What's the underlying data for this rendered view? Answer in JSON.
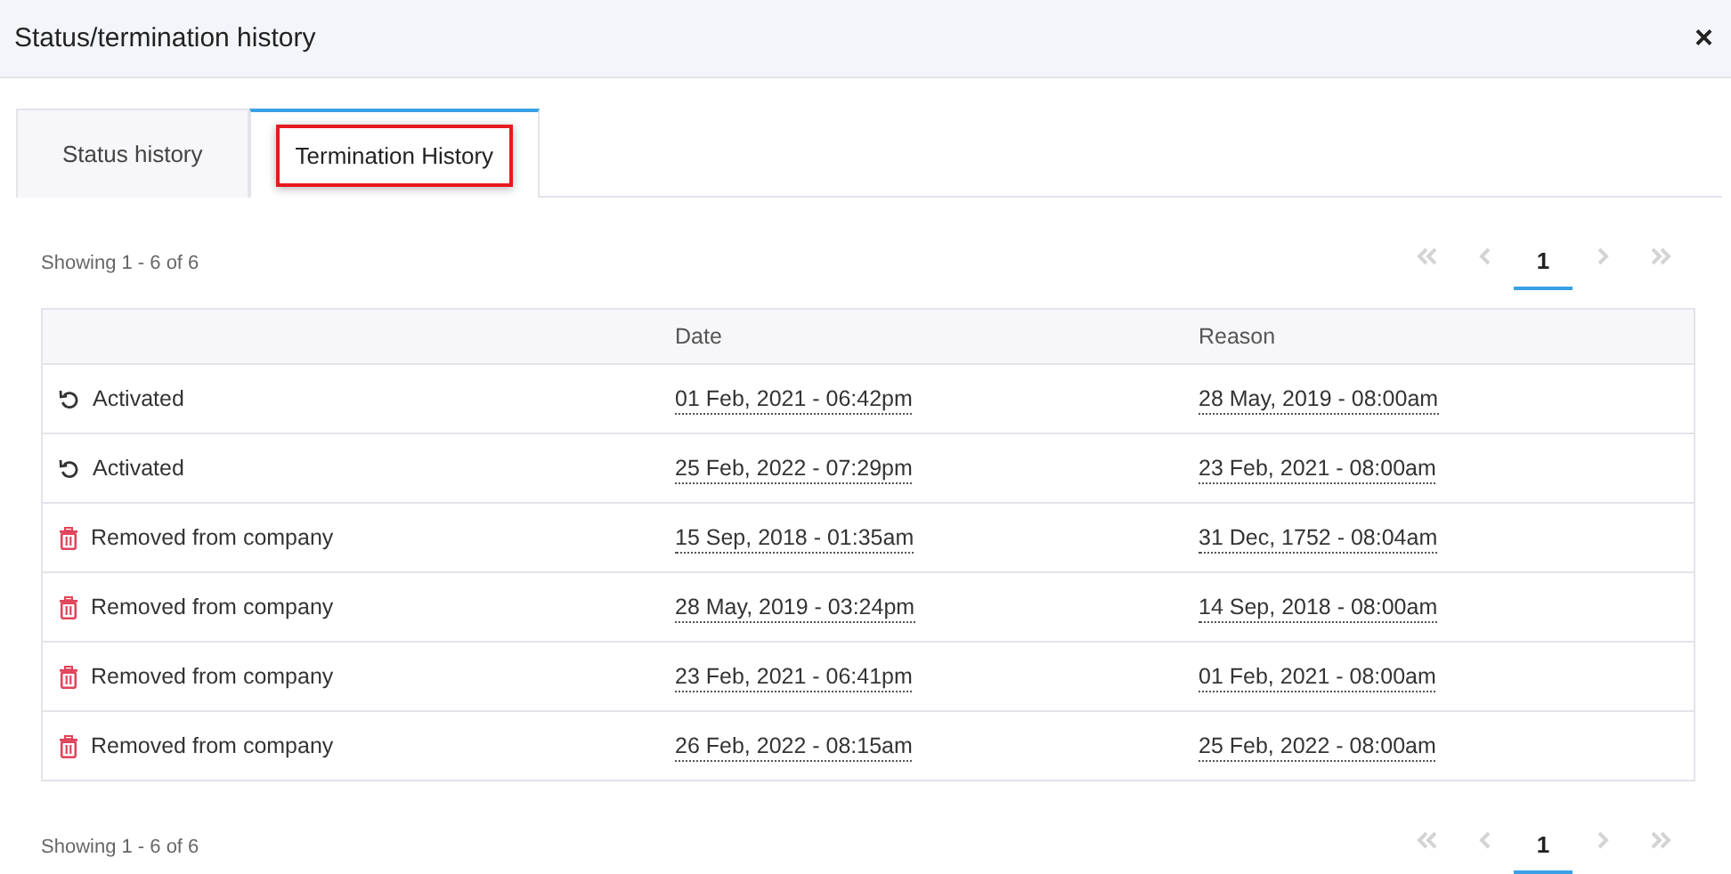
{
  "window": {
    "title": "Status/termination history",
    "close": "×"
  },
  "tabs": [
    {
      "label": "Status history",
      "selected": false,
      "highlighted": false
    },
    {
      "label": "Termination History",
      "selected": true,
      "highlighted": true
    }
  ],
  "summary_top": "Showing 1 - 6 of 6",
  "pager_top": [
    {
      "kind": "first",
      "disabled": true
    },
    {
      "kind": "prev",
      "disabled": true
    },
    {
      "kind": "page",
      "label": "1",
      "selected": true
    },
    {
      "kind": "next",
      "disabled": true
    },
    {
      "kind": "last",
      "disabled": true
    }
  ],
  "table": {
    "columns": [
      "Date",
      "Reason"
    ],
    "rows": [
      {
        "kind": "activated",
        "status": "Activated",
        "date": "01 Feb, 2021 - 06:42pm",
        "reason": "28 May, 2019 - 08:00am"
      },
      {
        "kind": "activated",
        "status": "Activated",
        "date": "25 Feb, 2022 - 07:29pm",
        "reason": "23 Feb, 2021 - 08:00am"
      },
      {
        "kind": "removed",
        "status": "Removed from company",
        "date": "15 Sep, 2018 - 01:35am",
        "reason": "31 Dec, 1752 - 08:04am"
      },
      {
        "kind": "removed",
        "status": "Removed from company",
        "date": "28 May, 2019 - 03:24pm",
        "reason": "14 Sep, 2018 - 08:00am"
      },
      {
        "kind": "removed",
        "status": "Removed from company",
        "date": "23 Feb, 2021 - 06:41pm",
        "reason": "01 Feb, 2021 - 08:00am"
      },
      {
        "kind": "removed",
        "status": "Removed from company",
        "date": "26 Feb, 2022 - 08:15am",
        "reason": "25 Feb, 2022 - 08:00am"
      }
    ]
  },
  "summary_bottom": "Showing 1 - 6 of 6",
  "pager_bottom": [
    {
      "kind": "first",
      "disabled": true
    },
    {
      "kind": "prev",
      "disabled": true
    },
    {
      "kind": "page",
      "label": "1",
      "selected": true
    },
    {
      "kind": "next",
      "disabled": true
    },
    {
      "kind": "last",
      "disabled": true
    }
  ]
}
